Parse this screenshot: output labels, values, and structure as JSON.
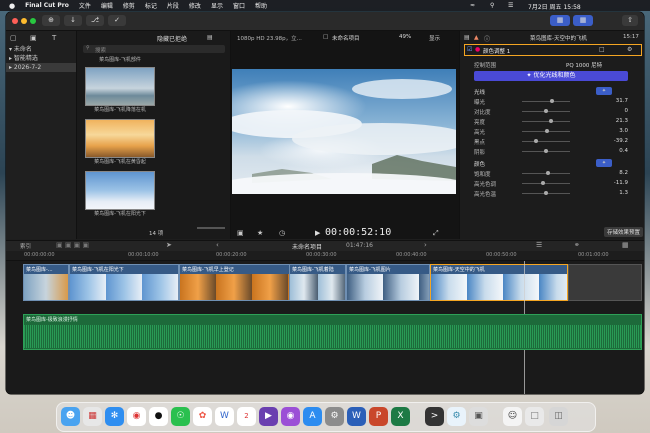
{
  "menubar": {
    "app_name": "Final Cut Pro",
    "menus": [
      "文件",
      "编辑",
      "修剪",
      "标记",
      "片段",
      "修改",
      "显示",
      "窗口",
      "帮助"
    ],
    "date_time": "7月2日 周五  15:58"
  },
  "browser": {
    "library": "未命名",
    "items": [
      "智能精选",
      "2026-7-2"
    ]
  },
  "clips": {
    "filter": "隐藏已拒绝",
    "search_placeholder": "搜索",
    "top_label": "菜鸟图库-飞机部件",
    "items": [
      {
        "label": "菜鸟图库-飞机降落在机"
      },
      {
        "label": "菜鸟图库-飞机在黄昏起"
      },
      {
        "label": "菜鸟图库-飞机在阳光下"
      }
    ],
    "count": "14 项"
  },
  "viewer": {
    "format": "1080p HD 23.98p，立...",
    "project": "未命名项目",
    "zoom": "49%",
    "display": "显示",
    "timecode": "00:00:52:10"
  },
  "inspector": {
    "clip_title": "菜鸟图库-天空中的飞机",
    "duration": "15:17",
    "effect": "颜色调整 1",
    "preset_label": "控制范围",
    "preset_value": "PQ 1000 尼特",
    "optimize_button": "优化光线和颜色",
    "section_light": "光线",
    "rows_light": [
      {
        "name": "曝光",
        "value": "31.7",
        "level": 0.62
      },
      {
        "name": "对比度",
        "value": "0",
        "level": 0.5
      },
      {
        "name": "亮度",
        "value": "21.3",
        "level": 0.6
      },
      {
        "name": "高光",
        "value": "3.0",
        "level": 0.52
      },
      {
        "name": "黑点",
        "value": "-39.2",
        "level": 0.3
      },
      {
        "name": "阴影",
        "value": "0.4",
        "level": 0.5
      }
    ],
    "section_color": "颜色",
    "rows_color": [
      {
        "name": "饱和度",
        "value": "8.2",
        "level": 0.55
      },
      {
        "name": "高光色调",
        "value": "-11.9",
        "level": 0.44
      },
      {
        "name": "高光色温",
        "value": "1.3",
        "level": 0.5
      }
    ],
    "save_preset": "存储效果预置"
  },
  "timeline_bar": {
    "index": "索引",
    "project": "未命名项目",
    "duration": "01:47:16"
  },
  "ruler": [
    "00:00:00:00",
    "00:00:10:00",
    "00:00:20:00",
    "00:00:30:00",
    "00:00:40:00",
    "00:00:50:00",
    "00:01:00:00"
  ],
  "timeline": {
    "video_clips": [
      "菜鸟图库-...",
      "菜鸟图库-飞机在阳光下",
      "菜鸟图库-飞机早上登记",
      "菜鸟图库-飞机着陆",
      "菜鸟图库-飞机图片",
      "菜鸟图库-天空中的飞机"
    ],
    "audio_clip": "菜鸟图库-极致浪漫抒情"
  },
  "dock": {
    "apps": [
      "finder-icon",
      "launchpad-icon",
      "safari-icon",
      "chrome-icon",
      "qq-icon",
      "wechat-icon",
      "photos-icon",
      "wps-icon",
      "calendar-icon",
      "final-cut-icon",
      "podcast-icon",
      "app-store-icon",
      "system-settings-icon",
      "word-icon",
      "powerpoint-icon",
      "excel-icon",
      "terminal-icon",
      "preview-icon",
      "disk-icon",
      "cat-icon",
      "folder-icon",
      "trash-icon"
    ]
  },
  "colors": {
    "accent": "#3b5ec8",
    "audio_green": "#1d6a3a",
    "clip_blue": "#365a86",
    "selection_orange": "#f5a623"
  }
}
